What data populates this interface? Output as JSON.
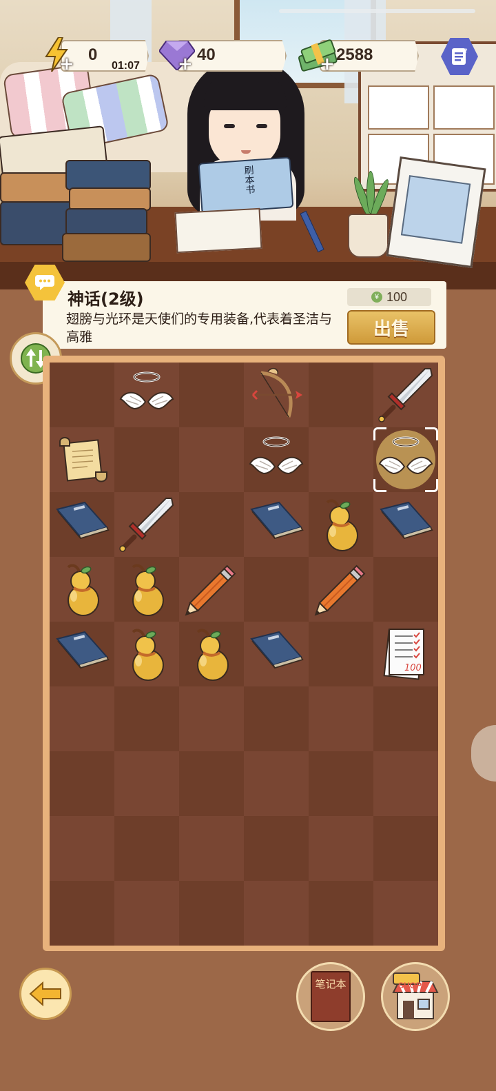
{
  "hud": {
    "energy": {
      "icon": "lightning-icon",
      "value": "0",
      "timer": "01:07"
    },
    "gems": {
      "icon": "gem-icon",
      "value": "40"
    },
    "cash": {
      "icon": "cash-icon",
      "value": "2588"
    },
    "menu_icon": "task-list-icon"
  },
  "info": {
    "title": "神话(2级)",
    "description": "翅膀与光环是天使们的专用装备,代表着圣洁与高雅",
    "price": "100",
    "sell_label": "出售"
  },
  "scene": {
    "held_book_text": "刷本书"
  },
  "board": {
    "columns": 6,
    "rows": 9,
    "cells": [
      [
        "",
        "angel-wings-halo",
        "",
        "cupid-bow-arrow",
        "",
        "sword"
      ],
      [
        "scroll",
        "",
        "",
        "angel-wings-halo",
        "",
        "angel-wings-halo-selected"
      ],
      [
        "book",
        "sword",
        "",
        "book",
        "gourd",
        "book"
      ],
      [
        "gourd",
        "gourd",
        "pencil",
        "",
        "pencil",
        ""
      ],
      [
        "book",
        "gourd",
        "gourd",
        "book",
        "",
        "test-paper"
      ],
      [
        "",
        "",
        "",
        "",
        "",
        ""
      ],
      [
        "",
        "",
        "",
        "",
        "",
        ""
      ],
      [
        "",
        "",
        "",
        "",
        "",
        ""
      ],
      [
        "",
        "",
        "",
        "",
        "",
        ""
      ]
    ],
    "test_paper_score": "100"
  },
  "bottom": {
    "notebook_label": "笔记本",
    "shop_label": "SHOP"
  },
  "colors": {
    "board_dark": "#6e3e2a",
    "board_light": "#794633",
    "board_frame": "#e8b27c",
    "sell_button": "#d9a84a"
  }
}
